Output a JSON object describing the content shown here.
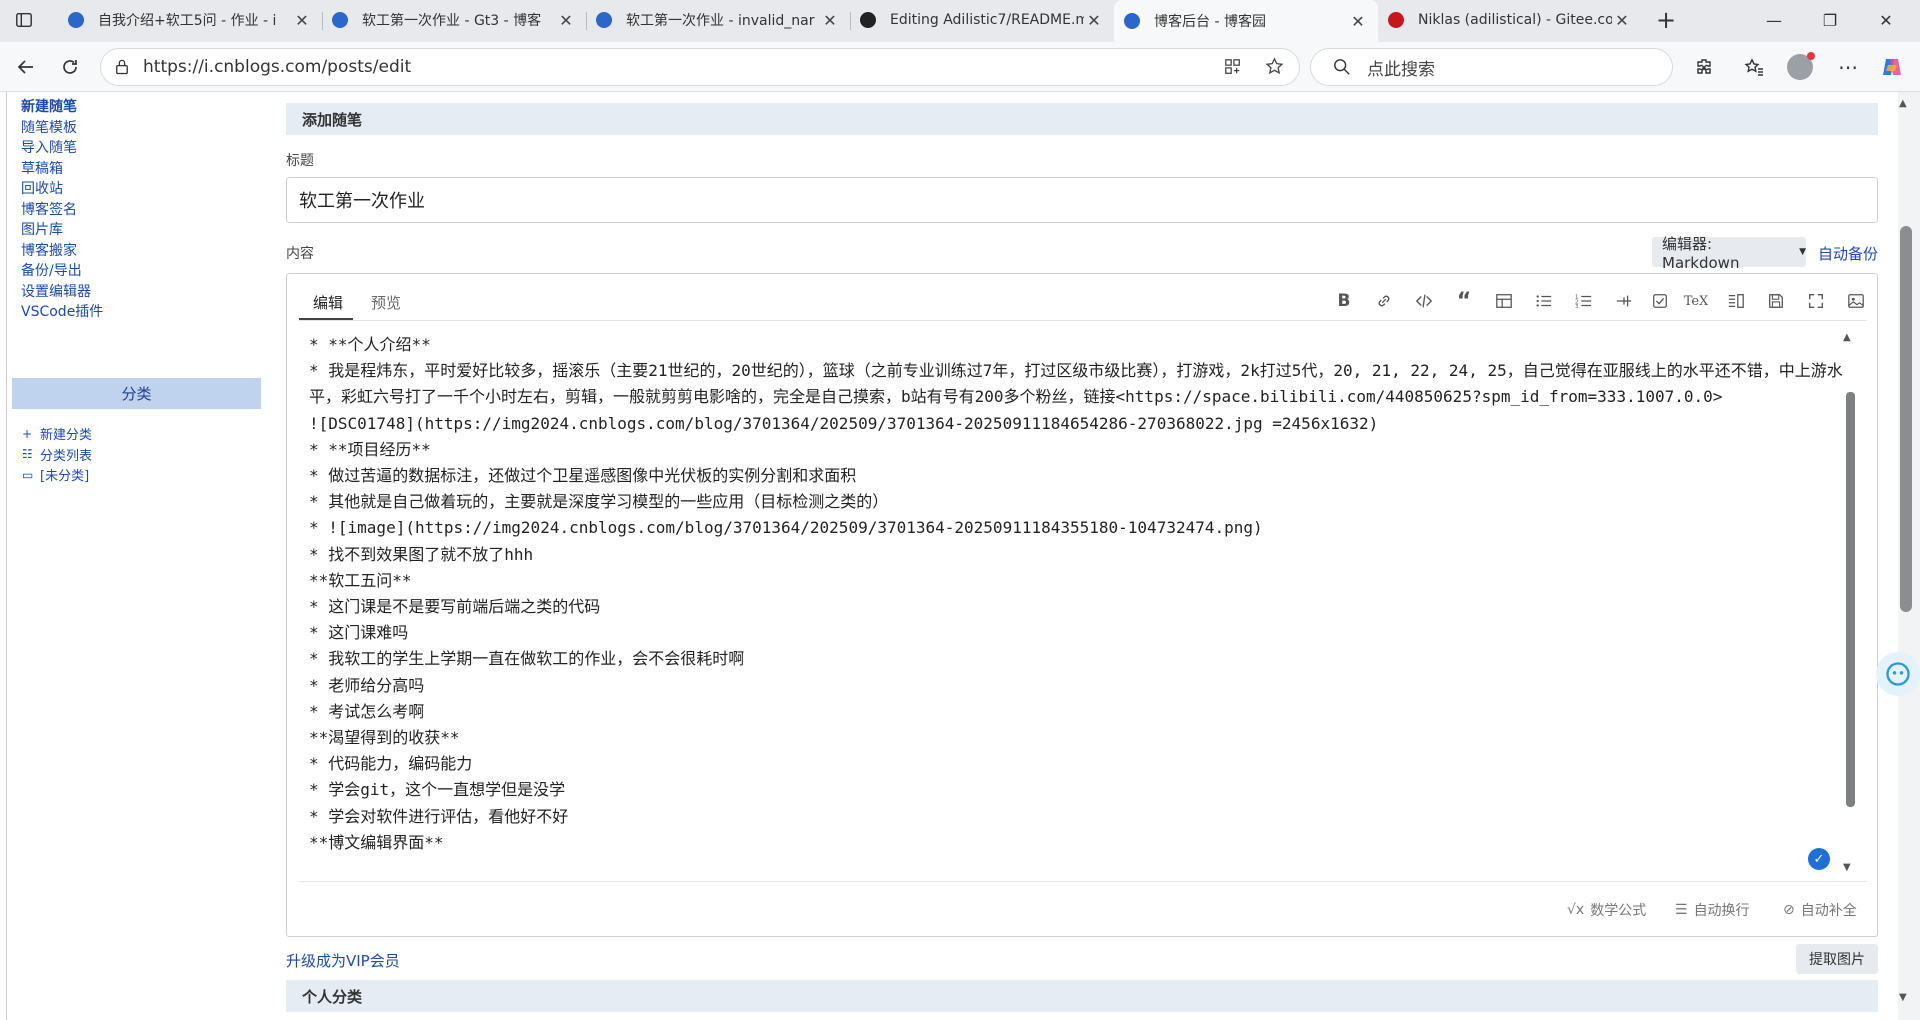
{
  "browser": {
    "tabs": [
      {
        "title": "自我介绍+软工5问 - 作业 - i",
        "color": "#2b66c9"
      },
      {
        "title": "软工第一次作业 - Gt3 - 博客",
        "color": "#2b66c9"
      },
      {
        "title": "软工第一次作业 - invalid_nar",
        "color": "#2b66c9"
      },
      {
        "title": "Editing Adilistic7/README.m",
        "color": "#222222"
      },
      {
        "title": "博客后台 - 博客园",
        "color": "#2b66c9"
      },
      {
        "title": "Niklas (adilistical) - Gitee.cor",
        "color": "#c7161e"
      }
    ],
    "active_tab": 4,
    "url": "https://i.cnblogs.com/posts/edit",
    "search_placeholder": "点此搜索"
  },
  "sidebar": {
    "items": [
      "新建随笔",
      "随笔模板",
      "导入随笔",
      "草稿箱",
      "回收站",
      "博客签名",
      "图片库",
      "博客搬家",
      "备份/导出",
      "设置编辑器",
      "VSCode插件"
    ],
    "category_header": "分类",
    "category_links": [
      {
        "label": "新建分类",
        "icon": "plus-icon"
      },
      {
        "label": "分类列表",
        "icon": "list-icon"
      },
      {
        "label": "[未分类]",
        "icon": "folder-icon"
      }
    ]
  },
  "main": {
    "section_title": "添加随笔",
    "title_label": "标题",
    "title_value": "软工第一次作业",
    "content_label": "内容",
    "editor_select": "编辑器: Markdown",
    "auto_backup": "自动备份",
    "editor_tabs": [
      "编辑",
      "预览"
    ],
    "content_lines": [
      "* **个人介绍**",
      "* 我是程炜东，平时爱好比较多，摇滚乐（主要21世纪的，20世纪的），篮球（之前专业训练过7年，打过区级市级比赛），打游戏，2k打过5代，20, 21, 22, 24, 25，自己觉得在亚服线上的水平还不错，中上游水平，彩虹六号打了一千个小时左右，剪辑，一般就剪剪电影啥的，完全是自己摸索，b站有号有200多个粉丝，链接<https://space.bilibili.com/440850625?spm_id_from=333.1007.0.0>",
      "![DSC01748](https://img2024.cnblogs.com/blog/3701364/202509/3701364-20250911184654286-270368022.jpg =2456x1632)",
      "* **项目经历**",
      "* 做过苦逼的数据标注，还做过个卫星遥感图像中光伏板的实例分割和求面积",
      "* 其他就是自己做着玩的，主要就是深度学习模型的一些应用（目标检测之类的）",
      "* ![image](https://img2024.cnblogs.com/blog/3701364/202509/3701364-20250911184355180-104732474.png)",
      "* 找不到效果图了就不放了hhh",
      "**软工五问**",
      "* 这门课是不是要写前端后端之类的代码",
      "* 这门课难吗",
      "* 我软工的学生上学期一直在做软工的作业，会不会很耗时啊",
      "* 老师给分高吗",
      "* 考试怎么考啊",
      "**渴望得到的收获**",
      "* 代码能力，编码能力",
      "* 学会git，这个一直想学但是没学",
      "* 学会对软件进行评估，看他好不好",
      "**博文编辑界面**"
    ],
    "bottom_tools": [
      {
        "label": "数学公式",
        "icon": "sqrt-icon"
      },
      {
        "label": "自动换行",
        "icon": "wrap-icon"
      },
      {
        "label": "自动补全",
        "icon": "autocomplete-icon"
      }
    ],
    "vip_link": "升级成为VIP会员",
    "extract_images": "提取图片",
    "personal_category": "个人分类"
  }
}
